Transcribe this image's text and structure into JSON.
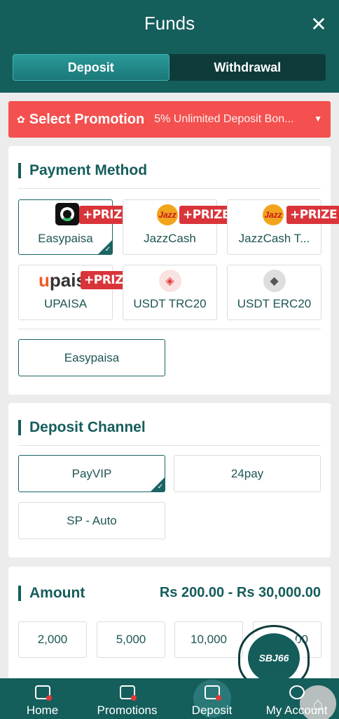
{
  "header": {
    "title": "Funds"
  },
  "tabs": [
    {
      "label": "Deposit",
      "active": true
    },
    {
      "label": "Withdrawal",
      "active": false
    }
  ],
  "promotion": {
    "label": "Select Promotion",
    "value": "5% Unlimited Deposit Bon..."
  },
  "payment_method": {
    "title": "Payment Method",
    "options": [
      {
        "label": "Easypaisa",
        "prize": "+PRIZE",
        "selected": true
      },
      {
        "label": "JazzCash",
        "prize": "+PRIZE",
        "selected": false
      },
      {
        "label": "JazzCash T...",
        "prize": "+PRIZE",
        "selected": false
      },
      {
        "label": "UPAISA",
        "prize": "+PRIZE",
        "logo_text": "upais",
        "selected": false
      },
      {
        "label": "USDT TRC20",
        "selected": false
      },
      {
        "label": "USDT ERC20",
        "selected": false
      }
    ],
    "sub_option": "Easypaisa"
  },
  "deposit_channel": {
    "title": "Deposit Channel",
    "options": [
      {
        "label": "PayVIP",
        "selected": true
      },
      {
        "label": "24pay",
        "selected": false
      },
      {
        "label": "SP - Auto",
        "selected": false
      }
    ]
  },
  "amount": {
    "title": "Amount",
    "range": "Rs 200.00 - Rs 30,000.00",
    "chips": [
      "2,000",
      "5,000",
      "10,000",
      "00"
    ]
  },
  "support": {
    "label": "SBJ66"
  },
  "bottom_nav": [
    {
      "label": "Home",
      "icon": "home-icon",
      "active": false
    },
    {
      "label": "Promotions",
      "icon": "gift-icon",
      "active": false
    },
    {
      "label": "Deposit",
      "icon": "wallet-icon",
      "active": true
    },
    {
      "label": "My Account",
      "icon": "user-icon",
      "active": false
    }
  ],
  "colors": {
    "primary": "#145e5c",
    "promo": "#f3504f",
    "prize": "#d9343a"
  }
}
